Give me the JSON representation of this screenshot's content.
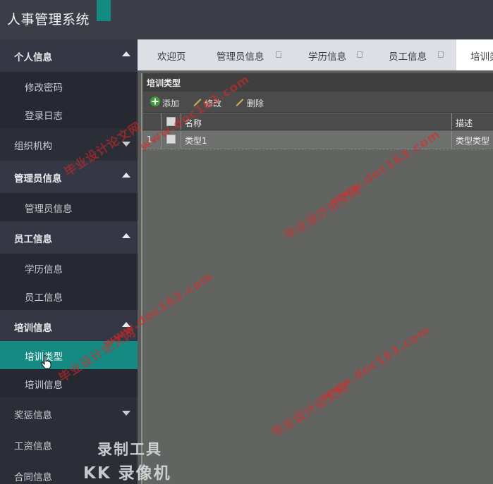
{
  "app": {
    "title": "人事管理系统"
  },
  "sidebar": {
    "groups": [
      {
        "label": "个人信息",
        "items": [
          "修改密码",
          "登录日志"
        ]
      },
      {
        "label": "组织机构",
        "items": []
      },
      {
        "label": "管理员信息",
        "items": [
          "管理员信息"
        ]
      },
      {
        "label": "员工信息",
        "items": [
          "学历信息",
          "员工信息"
        ]
      },
      {
        "label": "培训信息",
        "items": [
          "培训类型",
          "培训信息"
        ]
      },
      {
        "label": "奖惩信息",
        "items": []
      },
      {
        "label": "工资信息",
        "items": []
      },
      {
        "label": "合同信息",
        "items": []
      }
    ],
    "active_item": "培训类型"
  },
  "tabs": [
    {
      "label": "欢迎页"
    },
    {
      "label": "管理员信息"
    },
    {
      "label": "学历信息"
    },
    {
      "label": "员工信息"
    },
    {
      "label": "培训类"
    }
  ],
  "panel": {
    "title": "培训类型",
    "toolbar": {
      "add": "添加",
      "edit": "修改",
      "delete": "删除"
    },
    "columns": [
      "名称",
      "描述"
    ],
    "rows": [
      {
        "index": "1",
        "name": "类型1",
        "desc": "类型类型"
      }
    ]
  },
  "watermark": {
    "site": "www.doc163.com",
    "cn": "毕业设计论文网"
  },
  "recorder": {
    "label": "录制工具",
    "brand": "KK 录像机"
  },
  "colors": {
    "accent": "#148a83",
    "sidebar_bg": "#2c2e37",
    "topbar_bg": "#3b3d47"
  }
}
